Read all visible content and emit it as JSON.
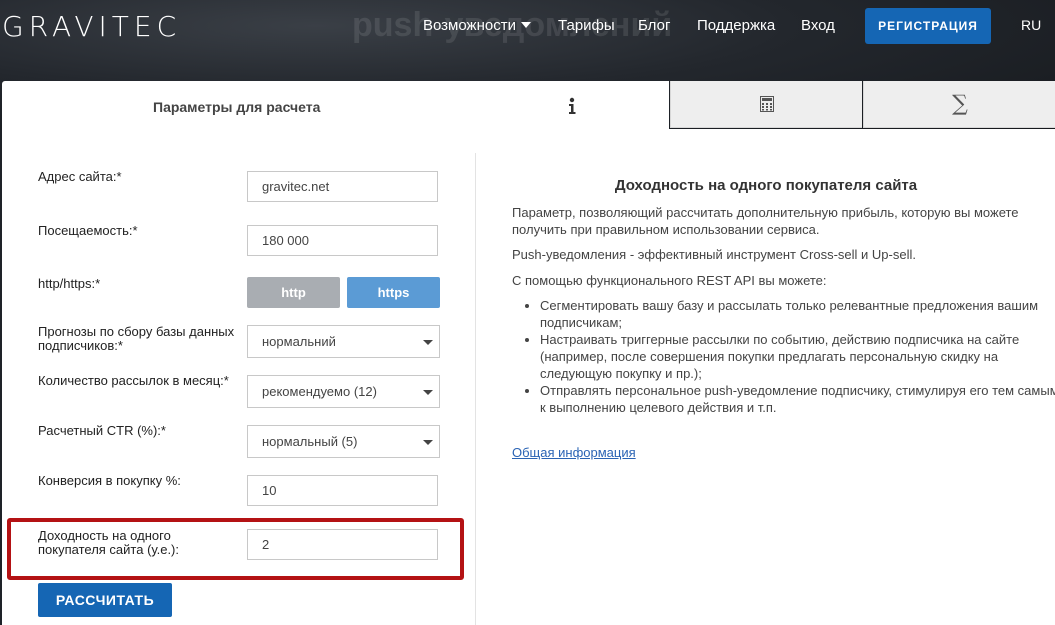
{
  "header": {
    "logo": "GRAVITEC",
    "hero_title": "push-уведомлений",
    "nav": {
      "features": "Возможности",
      "pricing": "Тарифы",
      "blog": "Блог",
      "support": "Поддержка",
      "login": "Вход"
    },
    "register_button": "РЕГИСТРАЦИЯ",
    "language": "RU"
  },
  "tabs": {
    "params_label": "Параметры для расчета",
    "info_icon": "info-icon",
    "calculator_icon": "calculator-icon",
    "sum_icon": "sigma-icon",
    "sum_glyph": "∑"
  },
  "form": {
    "site_label": "Адрес сайта:*",
    "site_value": "gravitec.net",
    "traffic_label": "Посещаемость:*",
    "traffic_value": "180 000",
    "protocol_label": "http/https:*",
    "protocol_options": [
      "http",
      "https"
    ],
    "protocol_selected": "https",
    "forecast_label": "Прогнозы по сбору базы данных подписчиков:*",
    "forecast_value": "нормальний",
    "mailings_label": "Количество рассылок в месяц:*",
    "mailings_value": "рекомендуемо (12)",
    "ctr_label": "Расчетный CTR (%):*",
    "ctr_value": "нормальный (5)",
    "conversion_label": "Конверсия в покупку %:",
    "conversion_value": "10",
    "revenue_label": "Доходность на одного покупателя сайта (у.е.):",
    "revenue_value": "2",
    "calculate_button": "РАССЧИТАТЬ"
  },
  "info": {
    "title": "Доходность на одного покупателя сайта",
    "paragraph1": "Параметр, позволяющий рассчитать дополнительную прибыль, которую вы можете получить при правильном использовании сервиса.",
    "paragraph2": "Push-уведомления - эффективный инструмент Cross-sell и Up-sell.",
    "paragraph3": "С помощью функционального REST API вы можете:",
    "bullets": [
      "Сегментировать вашу базу и рассылать только релевантные предложения вашим подписчикам;",
      "Настраивать триггерные рассылки по событию, действию подписчика на сайте (например, после совершения покупки предлагать персональную скидку на следующую покупку и пр.);",
      "Отправлять персональное push-уведомление подписчику, стимулируя его тем самым к выполнению целевого действия и т.п."
    ],
    "link": "Общая информация"
  },
  "colors": {
    "brand_blue": "#1566b4",
    "highlight_red": "#b41214",
    "https_active": "#5b9bd5",
    "http_inactive": "#a9adb2"
  }
}
